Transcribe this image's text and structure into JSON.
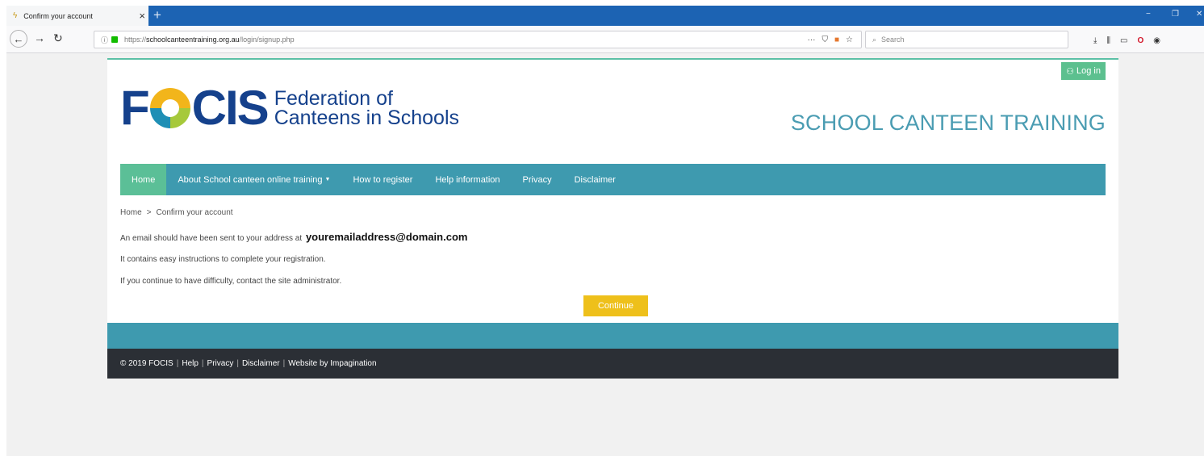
{
  "browser": {
    "tab_title": "Confirm your account",
    "tab_close": "×",
    "new_tab": "+",
    "min": "−",
    "restore": "❐",
    "close": "✕",
    "url_prefix": "https://",
    "url_domain": "schoolcanteentraining.org.au",
    "url_path": "/login/signup.php",
    "search_placeholder": "Search"
  },
  "header": {
    "login_label": "Log in",
    "logo_left": "F",
    "logo_right": "CIS",
    "logo_line1": "Federation of",
    "logo_line2": "Canteens in Schools",
    "site_title": "SCHOOL CANTEEN TRAINING"
  },
  "nav": {
    "items": [
      {
        "label": "Home"
      },
      {
        "label": "About School canteen online training"
      },
      {
        "label": "How to register"
      },
      {
        "label": "Help information"
      },
      {
        "label": "Privacy"
      },
      {
        "label": "Disclaimer"
      }
    ]
  },
  "breadcrumb": {
    "home": "Home",
    "sep": ">",
    "current": "Confirm your account"
  },
  "main": {
    "line1": "An email should have been sent to your address at",
    "email": "youremailaddress@domain.com",
    "line2": "It contains easy instructions to complete your registration.",
    "line3": "If you continue to have difficulty, contact the site administrator.",
    "continue_label": "Continue"
  },
  "footer": {
    "copyright": "© 2019 FOCIS",
    "help": "Help",
    "privacy": "Privacy",
    "disclaimer": "Disclaimer",
    "website_by": "Website by Impagination",
    "sep": "|"
  }
}
